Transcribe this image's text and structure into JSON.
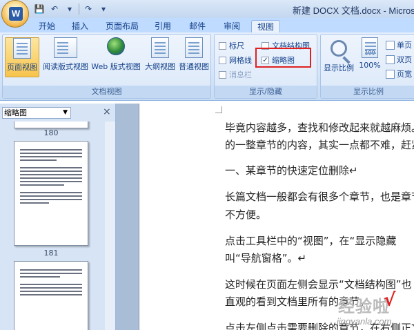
{
  "window": {
    "title": "新建 DOCX 文档.docx - Microsoft"
  },
  "office_logo": "W",
  "qat": {
    "save_icon": "💾",
    "undo_icon": "↶",
    "redo_icon": "↷",
    "dropdown_icon": "▾"
  },
  "tabs": [
    "开始",
    "插入",
    "页面布局",
    "引用",
    "邮件",
    "审阅",
    "视图"
  ],
  "active_tab": "视图",
  "ribbon": {
    "doc_views": {
      "label": "文档视图",
      "buttons": [
        "页面视图",
        "阅读版式视图",
        "Web 版式视图",
        "大纲视图",
        "普通视图"
      ],
      "selected": "页面视图"
    },
    "show_hide": {
      "label": "显示/隐藏",
      "ruler": "标尺",
      "gridlines": "网格线",
      "message_bar": "消息栏",
      "doc_map": "文档结构图",
      "thumbnails": "缩略图",
      "thumbnails_checked": true,
      "check_mark": "✓"
    },
    "zoom": {
      "label": "显示比例",
      "zoom_button": "显示比例",
      "hundred": "100%",
      "one_page": "单页",
      "two_pages": "双页",
      "page_width": "页宽",
      "hundred_icon_text": "100"
    }
  },
  "nav_pane": {
    "select_value": "缩略图",
    "dropdown_arrow": "▼",
    "close": "×",
    "page_numbers": [
      "180",
      "181"
    ]
  },
  "document": {
    "paragraphs": [
      "毕竟内容越多，查找和修改起来就越麻烦。",
      "的一整章节的内容，其实一点都不难，赶紧",
      "一、某章节的快速定位删除↵",
      "长篇文档一般都会有很多个章节，也是章节",
      "不方便。",
      "点击工具栏中的“视图”，在“显示隐藏",
      "叫“导航窗格”。↵",
      "这时候在页面左侧会显示“文档结构图”也",
      "直观的看到文档里所有的章节。",
      "点击左侧点击需要删除的章节，在右侧正文"
    ]
  },
  "watermark": {
    "main": "经验啦",
    "check": "√",
    "url": "jingyanla.com"
  },
  "colors": {
    "highlight_box": "#e02020",
    "ribbon_bg": "#dbe8f9",
    "tab_bg": "#bfdbff"
  }
}
